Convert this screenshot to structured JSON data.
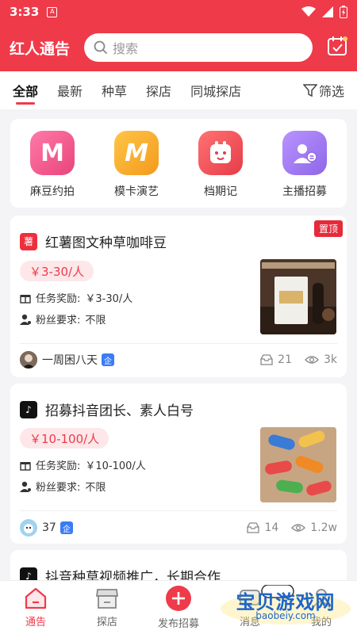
{
  "status": {
    "time": "3:33"
  },
  "header": {
    "title": "红人通告",
    "search_placeholder": "搜索"
  },
  "tabs": [
    {
      "label": "全部"
    },
    {
      "label": "最新"
    },
    {
      "label": "种草"
    },
    {
      "label": "探店"
    },
    {
      "label": "同城探店"
    }
  ],
  "filter_label": "筛选",
  "categories": [
    {
      "label": "麻豆约拍",
      "glyph": "M",
      "color": "#f0588c"
    },
    {
      "label": "模卡演艺",
      "glyph": "M",
      "color": "#f5a623"
    },
    {
      "label": "档期记",
      "glyph": "",
      "color": "#f2545b"
    },
    {
      "label": "主播招募",
      "glyph": "",
      "color": "#a17cf0"
    }
  ],
  "cards": [
    {
      "title": "红薯图文种草咖啡豆",
      "platform_glyph": "薯",
      "badge": "置顶",
      "price": "￥3-30/人",
      "reward_label": "任务奖励:",
      "reward_value": "￥3-30/人",
      "fans_label": "粉丝要求:",
      "fans_value": "不限",
      "author": "一周困八天",
      "verified": "企",
      "applicants": "21",
      "views": "3k"
    },
    {
      "title": "招募抖音团长、素人白号",
      "platform_glyph": "♪",
      "price": "￥10-100/人",
      "reward_label": "任务奖励:",
      "reward_value": "￥10-100/人",
      "fans_label": "粉丝要求:",
      "fans_value": "不限",
      "author": "37",
      "verified": "企",
      "applicants": "14",
      "views": "1.2w"
    },
    {
      "title": "抖音种草视频推广，长期合作",
      "platform_glyph": "♪"
    }
  ],
  "nav": [
    {
      "label": "通告"
    },
    {
      "label": "探店"
    },
    {
      "label": "发布招募"
    },
    {
      "label": "消息"
    },
    {
      "label": "我的"
    }
  ],
  "watermark": {
    "text": "宝贝游戏网",
    "url": "baobeiy.com"
  }
}
